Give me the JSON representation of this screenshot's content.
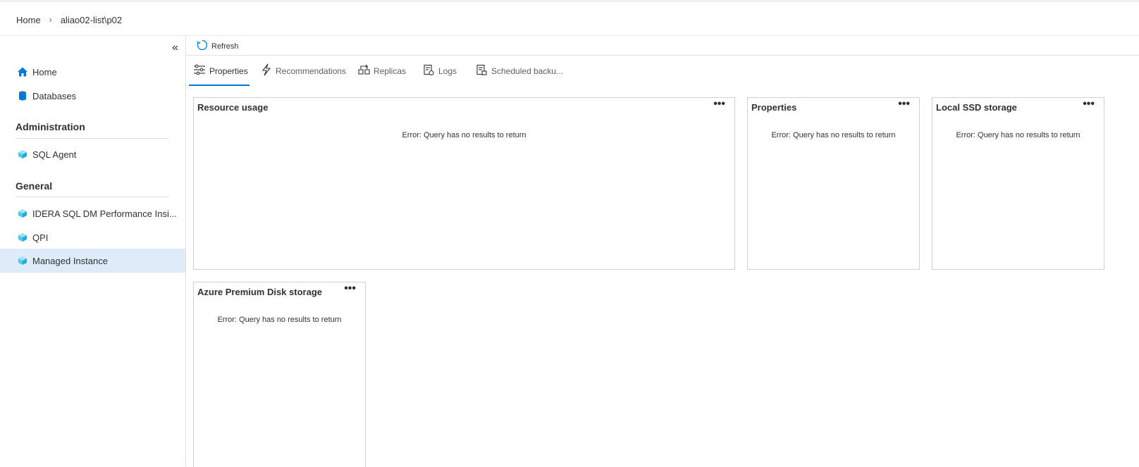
{
  "breadcrumb": {
    "home": "Home",
    "separator": "›",
    "current": "aliao02-list\\p02"
  },
  "sidebar": {
    "collapse_icon": "«",
    "items_top": [
      {
        "label": "Home",
        "icon": "home-icon"
      },
      {
        "label": "Databases",
        "icon": "database-icon"
      }
    ],
    "sections": [
      {
        "title": "Administration",
        "items": [
          {
            "label": "SQL Agent",
            "icon": "cube-icon"
          }
        ]
      },
      {
        "title": "General",
        "items": [
          {
            "label": "IDERA SQL DM Performance Insi...",
            "icon": "cube-icon"
          },
          {
            "label": "QPI",
            "icon": "cube-icon"
          },
          {
            "label": "Managed Instance",
            "icon": "cube-icon",
            "selected": true
          }
        ]
      }
    ]
  },
  "toolbar": {
    "refresh_label": "Refresh"
  },
  "tabs": [
    {
      "label": "Properties",
      "icon": "sliders-icon",
      "active": true
    },
    {
      "label": "Recommendations",
      "icon": "lightning-icon"
    },
    {
      "label": "Replicas",
      "icon": "replicas-icon"
    },
    {
      "label": "Logs",
      "icon": "logs-icon"
    },
    {
      "label": "Scheduled backu...",
      "icon": "scheduled-backup-icon"
    }
  ],
  "cards": [
    {
      "title": "Resource usage",
      "more": "•••",
      "message": "Error: Query has no results to return"
    },
    {
      "title": "Properties",
      "more": "•••",
      "message": "Error: Query has no results to return"
    },
    {
      "title": "Local SSD storage",
      "more": "•••",
      "message": "Error: Query has no results to return"
    },
    {
      "title": "Azure Premium Disk storage",
      "more": "•••",
      "message": "Error: Query has no results to return"
    }
  ],
  "colors": {
    "accent": "#0078d4",
    "selected_bg": "#deecf9",
    "cube": "#50c8f0"
  }
}
